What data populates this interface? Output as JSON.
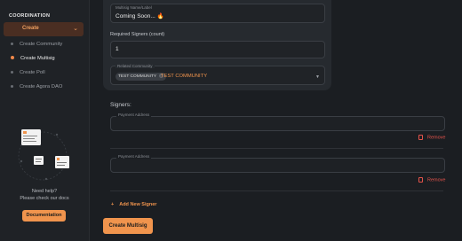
{
  "sidebar": {
    "section_title": "COORDINATION",
    "create_label": "Create",
    "items": [
      {
        "label": "Create Community"
      },
      {
        "label": "Create Multisig"
      },
      {
        "label": "Create Poll"
      },
      {
        "label": "Create Agora DAO"
      }
    ],
    "help_line1": "Need help?",
    "help_line2": "Please check our docs",
    "docs_button": "Documentation"
  },
  "form": {
    "name_label": "Multisig Name/Label",
    "name_value": "Coming Soon... 🔥",
    "required_signers_label": "Required Signers (count)",
    "required_signers_value": "1",
    "community_label": "Related Community",
    "community_chip": "TEST COMMUNITY",
    "community_value": "TEST COMMUNITY",
    "signers_title": "Signers:",
    "payment_address_label": "Payment Address",
    "remove_label": "Remove",
    "add_signer_label": "Add New Signer",
    "submit_label": "Create Multisig"
  },
  "colors": {
    "accent": "#f0944d",
    "danger": "#e5534b",
    "background": "#1b1e22",
    "card": "#262a2f"
  }
}
